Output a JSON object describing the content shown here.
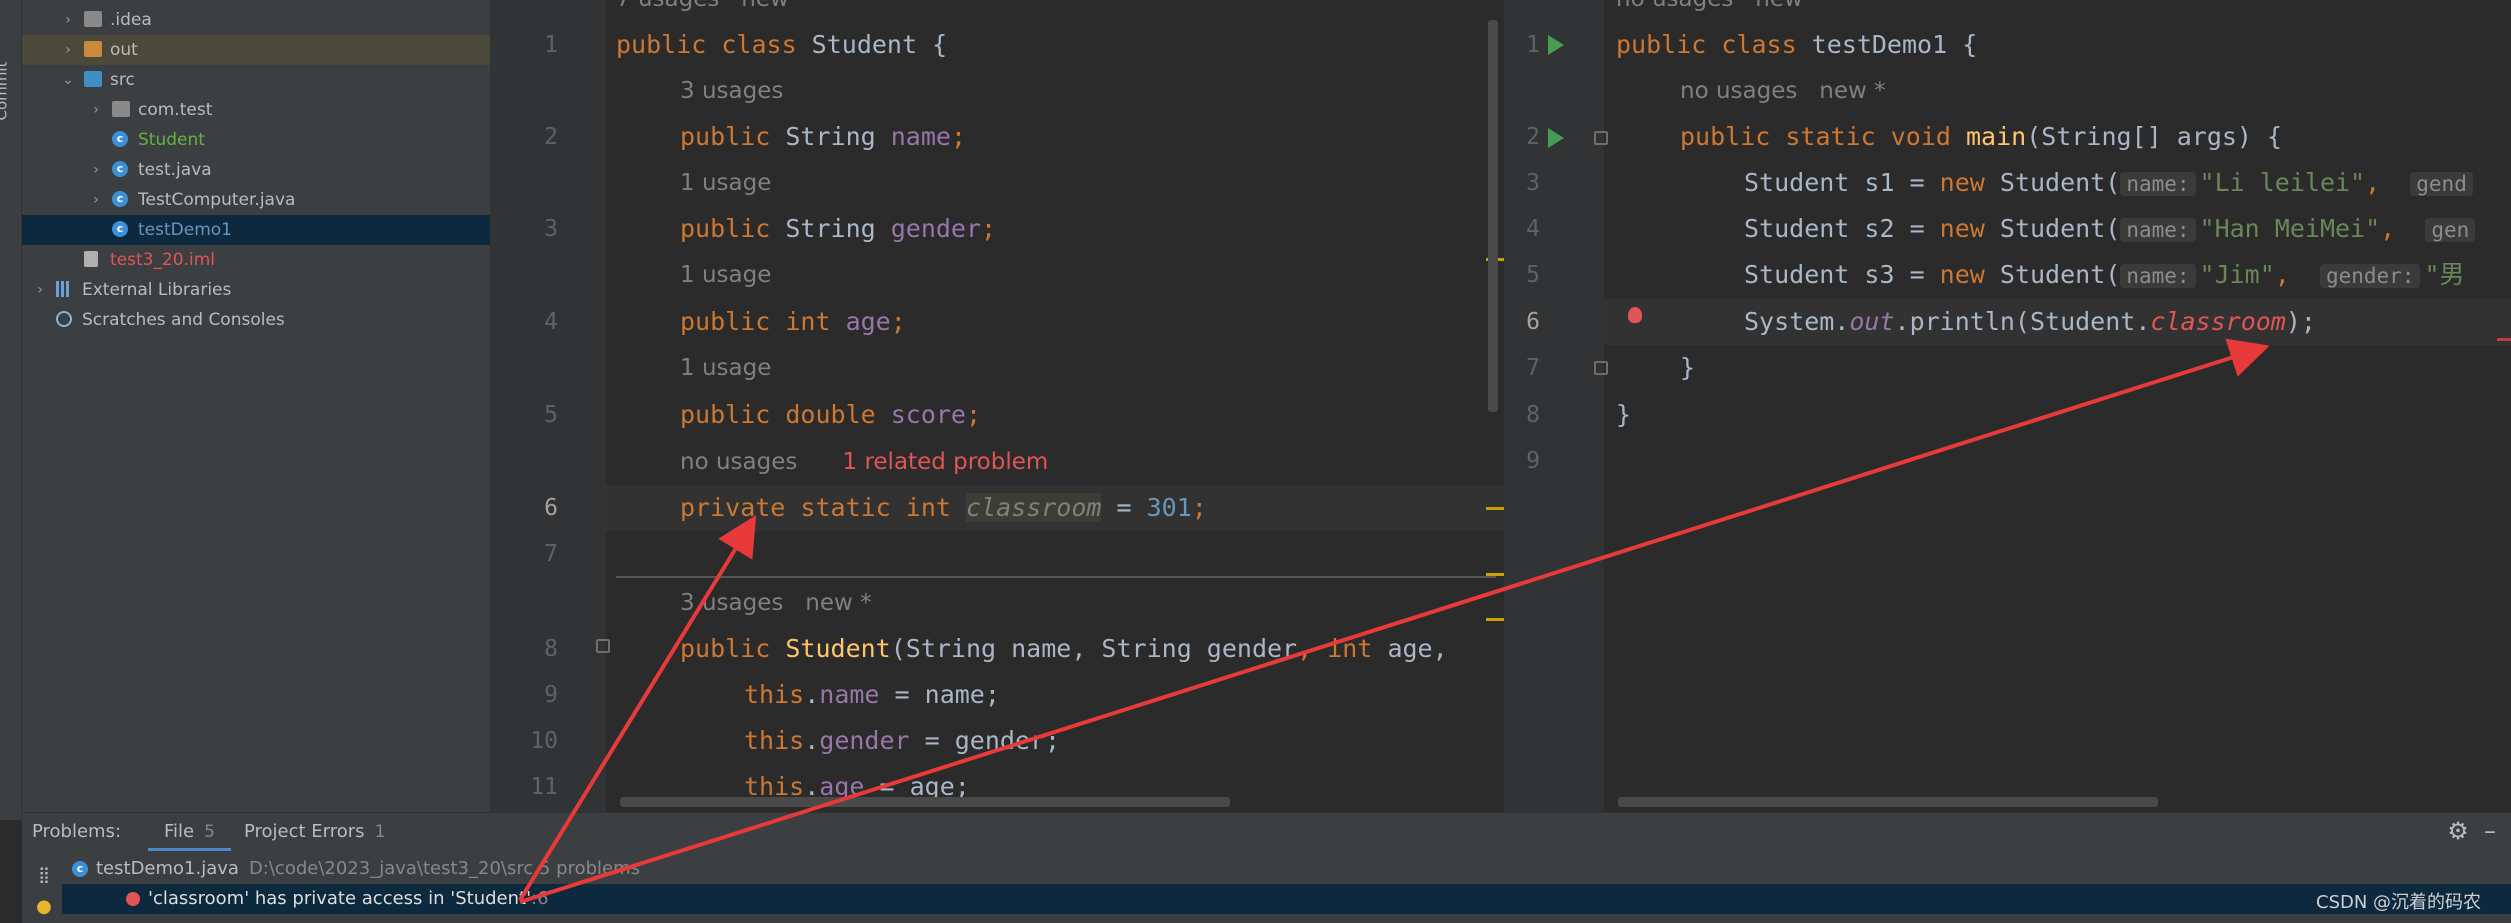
{
  "tool_strip": {
    "commit_label": "Commit"
  },
  "project_tree": [
    {
      "label": ".idea",
      "icon": "folder-icon",
      "indent": 1,
      "arrow": "›",
      "color": "#bbbbbb"
    },
    {
      "label": "out",
      "icon": "folder-icon",
      "indent": 1,
      "arrow": "›",
      "color": "#bbbbbb",
      "highlight": "#4b4a3a"
    },
    {
      "label": "src",
      "icon": "folder-icon",
      "indent": 1,
      "arrow": "⌄",
      "color": "#bbbbbb"
    },
    {
      "label": "com.test",
      "icon": "package-icon",
      "indent": 2,
      "arrow": "›",
      "color": "#bbbbbb"
    },
    {
      "label": "Student",
      "icon": "class-icon",
      "indent": 2,
      "arrow": "",
      "color": "#62b543"
    },
    {
      "label": "test.java",
      "icon": "class-icon",
      "indent": 2,
      "arrow": "›",
      "color": "#bbbbbb"
    },
    {
      "label": "TestComputer.java",
      "icon": "class-icon",
      "indent": 2,
      "arrow": "›",
      "color": "#bbbbbb"
    },
    {
      "label": "testDemo1",
      "icon": "class-icon",
      "indent": 2,
      "arrow": "",
      "color": "#6897bb",
      "highlight": "#0d293e"
    },
    {
      "label": "test3_20.iml",
      "icon": "iml-icon",
      "indent": 1,
      "arrow": "",
      "color": "#e05555"
    },
    {
      "label": "External Libraries",
      "icon": "library-icon",
      "indent": 0,
      "arrow": "›",
      "color": "#bbbbbb"
    },
    {
      "label": "Scratches and Consoles",
      "icon": "scratches-icon",
      "indent": 0,
      "arrow": "",
      "color": "#bbbbbb"
    }
  ],
  "editor_left": {
    "top_hint": "7 usages   new",
    "line_numbers": [
      "1",
      "2",
      "3",
      "4",
      "5",
      "6",
      "7",
      "8",
      "9",
      "10",
      "11"
    ],
    "hint_3usages": "3 usages",
    "hint_1usage_a": "1 usage",
    "hint_1usage_b": "1 usage",
    "hint_1usage_c": "1 usage",
    "hint_nousages": "no usages",
    "hint_related": "1 related problem",
    "hint_ctor": "3 usages   new *",
    "code": {
      "l1_kw": "public class ",
      "l1_name": "Student",
      "l1_end": " {",
      "l2_kw": "public ",
      "l2_type": "String ",
      "l2_field": "name",
      "l2_end": ";",
      "l3_kw": "public ",
      "l3_type": "String ",
      "l3_field": "gender",
      "l3_end": ";",
      "l4_kw": "public int ",
      "l4_field": "age",
      "l4_end": ";",
      "l5_kw": "public double ",
      "l5_field": "score",
      "l5_end": ";",
      "l6_kw": "private static int ",
      "l6_field": "classroom",
      "l6_eq": " = ",
      "l6_num": "301",
      "l6_end": ";",
      "l8_kw": "public ",
      "l8_name": "Student",
      "l8_params_a": "(String name, String gender",
      "l8_comma": ", ",
      "l8_int": "int ",
      "l8_params_b": "age,",
      "l9_this": "this",
      "l9_dot": ".",
      "l9_field": "name",
      "l9_rest": " = name;",
      "l10_this": "this",
      "l10_dot": ".",
      "l10_field": "gender",
      "l10_rest": " = gender;",
      "l11_this": "this",
      "l11_dot": ".",
      "l11_field": "age",
      "l11_rest": " = age;"
    }
  },
  "editor_right": {
    "top_hint": "no usages   new",
    "line_numbers": [
      "1",
      "2",
      "3",
      "4",
      "5",
      "6",
      "7",
      "8",
      "9"
    ],
    "hint_main": "no usages   new *",
    "code": {
      "l1_kw": "public class ",
      "l1_name": "testDemo1",
      "l1_end": " {",
      "l2_kw": "public static void ",
      "l2_name": "main",
      "l2_rest": "(String[] args) {",
      "l3_decl": "Student s1 = ",
      "l3_new": "new ",
      "l3_ctor": "Student(",
      "l3_inlay1": "name:",
      "l3_str": "\"Li leilei\"",
      "l3_comma": ",  ",
      "l3_inlay2": "gend",
      "l4_decl": "Student s2 = ",
      "l4_new": "new ",
      "l4_ctor": "Student(",
      "l4_inlay1": "name:",
      "l4_str": "\"Han MeiMei\"",
      "l4_comma": ",  ",
      "l4_inlay2": "gen",
      "l5_decl": "Student s3 = ",
      "l5_new": "new ",
      "l5_ctor": "Student(",
      "l5_inlay1": "name:",
      "l5_str": "\"Jim\"",
      "l5_comma": ",  ",
      "l5_inlay2": "gender:",
      "l5_str2": "\"男",
      "l6_sys": "System.",
      "l6_out": "out",
      "l6_print": ".println(Student.",
      "l6_err": "classroom",
      "l6_end": ");",
      "l7": "}",
      "l8": "}"
    }
  },
  "problems": {
    "title": "Problems:",
    "tab_file": "File",
    "tab_file_count": "5",
    "tab_project": "Project Errors",
    "tab_project_count": "1",
    "file_row": "testDemo1.java",
    "file_path": "D:\\code\\2023_java\\test3_20\\src  5 problems",
    "error_row": "'classroom' has private access in 'Student'",
    "error_line": ":6"
  },
  "watermark": "CSDN @沉着的码农",
  "colors": {
    "arrow": "#e83a3a",
    "accent": "#4a88c7"
  }
}
